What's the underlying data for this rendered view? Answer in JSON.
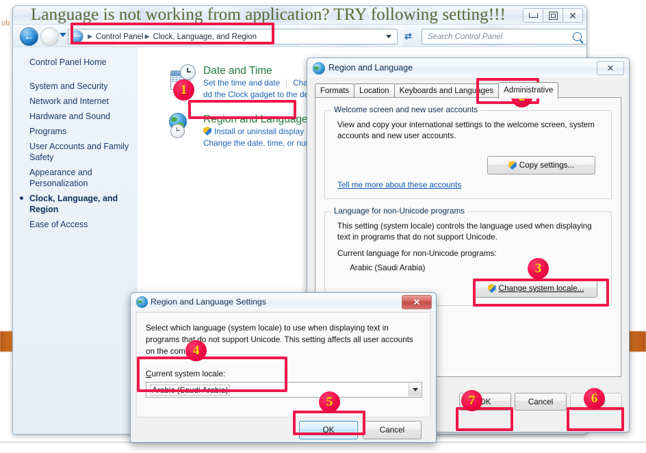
{
  "slide": {
    "heading": "Language is not working from application? TRY following setting!!!",
    "ghost_left": "ob",
    "ghost_top": ""
  },
  "control_panel": {
    "window_buttons": {
      "minimize": "minimize-icon",
      "maximize": "maximize-icon",
      "close": "✕"
    },
    "nav": {
      "back": "back-arrow-icon",
      "forward": "forward-arrow-icon",
      "recent_pages": "chevron-down-icon",
      "address_icon": "control-panel-icon",
      "breadcrumbs": [
        "Control Panel",
        "Clock, Language, and Region"
      ],
      "address_dropdown": "chevron-down-icon",
      "refresh": "refresh-icon"
    },
    "search": {
      "placeholder": "Search Control Panel",
      "icon": "search-icon"
    },
    "sidebar": {
      "home": "Control Panel Home",
      "items": [
        {
          "label": "System and Security",
          "selected": false
        },
        {
          "label": "Network and Internet",
          "selected": false
        },
        {
          "label": "Hardware and Sound",
          "selected": false
        },
        {
          "label": "Programs",
          "selected": false
        },
        {
          "label": "User Accounts and Family Safety",
          "selected": false
        },
        {
          "label": "Appearance and Personalization",
          "selected": false
        },
        {
          "label": "Clock, Language, and Region",
          "selected": true
        },
        {
          "label": "Ease of Access",
          "selected": false
        }
      ]
    },
    "categories": [
      {
        "title": "Date and Time",
        "icon": "calendar-clock-icon",
        "links": [
          "Set the time and date",
          "Chang",
          "dd the Clock gadget to the des"
        ]
      },
      {
        "title": "Region and Language",
        "icon": "globe-clock-icon",
        "links": [
          "Install or uninstall display lan",
          "Change the date, time, or numb"
        ]
      }
    ]
  },
  "region_dialog": {
    "title": "Region and Language",
    "title_icon": "globe-icon",
    "close": "✕",
    "tabs": [
      {
        "label": "Formats",
        "active": false
      },
      {
        "label": "Location",
        "active": false
      },
      {
        "label": "Keyboards and Languages",
        "active": false
      },
      {
        "label": "Administrative",
        "active": true
      }
    ],
    "welcome_group": {
      "label": "Welcome screen and new user accounts",
      "description": "View and copy your international settings to the welcome screen, system accounts and new user accounts.",
      "copy_button": "Copy settings...",
      "copy_button_shield": "uac-shield-icon",
      "link": "Tell me more about these accounts"
    },
    "nonunicode_group": {
      "label": "Language for non-Unicode programs",
      "description": "This setting (system locale) controls the language used when displaying text in programs that do not support Unicode.",
      "current_label": "Current language for non-Unicode programs:",
      "current_value": "Arabic (Saudi Arabia)",
      "change_button": "Change system locale...",
      "change_button_shield": "uac-shield-icon"
    },
    "footer": {
      "ok": "OK",
      "cancel": "Cancel",
      "apply": "Apply",
      "apply_disabled": true
    }
  },
  "settings_dialog": {
    "title": "Region and Language Settings",
    "title_icon": "globe-icon",
    "close": "✕",
    "description": "Select which language (system locale) to use when displaying text in programs that do not support Unicode. This setting affects all user accounts on the computer.",
    "locale_label": "Current system locale:",
    "locale_value": "Arabic (Saudi Arabia)",
    "locale_dropdown": "chevron-down-icon",
    "ok": "OK",
    "cancel": "Cancel"
  },
  "annotations": {
    "accent": "#f0174b",
    "badge_text_color": "#ffe000",
    "badges": [
      {
        "n": "1",
        "target": "region-and-language-category-link"
      },
      {
        "n": "2",
        "target": "administrative-tab"
      },
      {
        "n": "3",
        "target": "change-system-locale-button"
      },
      {
        "n": "4",
        "target": "current-system-locale-field"
      },
      {
        "n": "5",
        "target": "settings-ok-button"
      },
      {
        "n": "6",
        "target": "apply-button"
      },
      {
        "n": "7",
        "target": "region-ok-button"
      }
    ]
  }
}
